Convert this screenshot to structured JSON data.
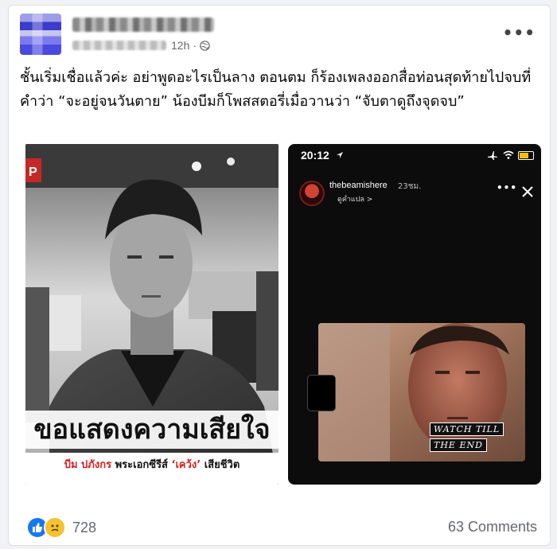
{
  "post": {
    "time": "12h",
    "separator": "·",
    "text": "ชั้นเริ่มเชื่อแล้วค่ะ อย่าพูดอะไรเป็นลาง ตอนตม ก็ร้องเพลงออกสื่อท่อนสุดท้ายไปจบที่คำว่า “จะอยู่จนวันตาย” น้องบีมก็โพสสตอรี่เมื่อวานว่า “จับตาดูถึงจุดจบ”"
  },
  "left_image": {
    "headline": "ขอแสดงความเสียใจ",
    "name_red": "บีม ปภังกร",
    "subtitle_mid": "พระเอกซีรีส์",
    "quote_red": "‘เคว้ง’",
    "subtitle_end": "เสียชีวิต",
    "corner_text": "P"
  },
  "right_image": {
    "clock": "20:12",
    "username": "thebeamishere",
    "time_ago": "23ชม.",
    "see_translation": "ดูคำแปล >",
    "caption_line1": "WATCH TILL",
    "caption_line2": "THE END"
  },
  "footer": {
    "reaction_count": "728",
    "comments": "63 Comments"
  },
  "colors": {
    "like_blue": "#1877f2",
    "sad_yellow": "#f7c12f",
    "thai_red": "#d6211f"
  }
}
